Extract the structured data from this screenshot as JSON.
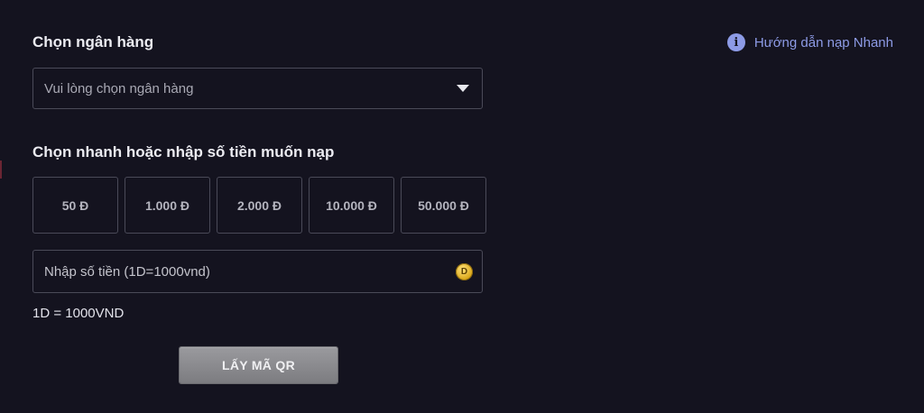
{
  "bank_section": {
    "title": "Chọn ngân hàng",
    "select_placeholder": "Vui lòng chọn ngân hàng"
  },
  "help": {
    "label": "Hướng dẫn nạp Nhanh",
    "icon": "info-icon",
    "icon_glyph": "i",
    "color": "#8d9be6"
  },
  "amount_section": {
    "title": "Chọn nhanh hoặc nhập số tiền muốn nạp",
    "options": [
      "50 Đ",
      "1.000 Đ",
      "2.000 Đ",
      "10.000 Đ",
      "50.000 Đ"
    ],
    "input_placeholder": "Nhập số tiền (1D=1000vnd)",
    "coin_icon_glyph": "D",
    "rate_note": "1D = 1000VND"
  },
  "actions": {
    "qr_button_label": "LẤY MÃ QR"
  }
}
